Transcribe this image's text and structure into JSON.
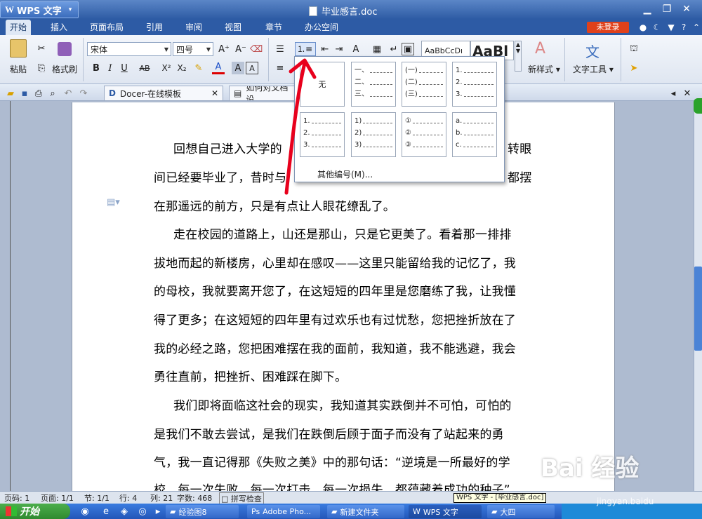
{
  "window": {
    "app_name": "WPS 文字",
    "doc_title": "毕业感言.doc"
  },
  "menu": {
    "tabs": [
      "开始",
      "插入",
      "页面布局",
      "引用",
      "审阅",
      "视图",
      "章节",
      "办公空间"
    ],
    "login": "未登录"
  },
  "ribbon": {
    "paste": "粘贴",
    "format_painter": "格式刷",
    "font_name": "宋体",
    "font_size": "四号",
    "styles_preview_1": "AaBbCcDı",
    "styles_preview_2": "AaBl",
    "new_style": "新样式",
    "text_tools": "文字工具"
  },
  "doc_tabs": [
    {
      "label": "Docer-在线模板"
    },
    {
      "label": "如何对文档设"
    }
  ],
  "numbering_dropdown": {
    "none_label": "无",
    "styles": [
      {
        "items": [
          "一、",
          "二、",
          "三、"
        ]
      },
      {
        "items": [
          "(一)",
          "(二)",
          "(三)"
        ]
      },
      {
        "items": [
          "1.",
          "2.",
          "3."
        ]
      },
      {
        "items": [
          "1.",
          "2.",
          "3."
        ]
      },
      {
        "items": [
          "1)",
          "2)",
          "3)"
        ]
      },
      {
        "items": [
          "①",
          "②",
          "③"
        ]
      },
      {
        "items": [
          "a.",
          "b.",
          "c."
        ]
      }
    ],
    "more": "其他编号(M)..."
  },
  "document": {
    "lines": [
      "回想自己进入大学的",
      "间已经要毕业了，昔时与",
      "在那遥远的前方，只是有点让人眼花缭乱了。",
      "走在校园的道路上，山还是那山，只是它更美了。看着那一排排",
      "拔地而起的新楼房，心里却在感叹——这里只能留给我的记忆了，我",
      "的母校，我就要离开您了，在这短短的四年里是您磨练了我，让我懂",
      "得了更多；在这短短的四年里有过欢乐也有过忧愁，您把挫折放在了",
      "我的必经之路，您把困难摆在我的面前，我知道，我不能逃避，我会",
      "勇往直前，把挫折、困难踩在脚下。",
      "我们即将面临这社会的现实，我知道其实跌倒并不可怕，可怕的",
      "是我们不敢去尝试，是我们在跌倒后顾于面子而没有了站起来的勇",
      "气，我一直记得那《失败之美》中的那句话：“逆境是一所最好的学",
      "校，每一次失败，每一次打击，每一次损失，都蕴藏着成功的种子”"
    ],
    "line1_tail": "转眼",
    "line2_tail": "都摆"
  },
  "status": {
    "page_code": "页码: 1",
    "page": "页面: 1/1",
    "section": "节: 1/1",
    "row": "行: 4",
    "col": "列: 21",
    "chars": "字数: 468",
    "spell": "拼写检查"
  },
  "tooltip": "WPS 文字 - [毕业感言.doc]",
  "taskbar": {
    "start": "开始",
    "tasks": [
      "经验图8",
      "Adobe Pho...",
      "新建文件夹",
      "WPS 文字",
      "大四"
    ]
  },
  "watermark": {
    "main": "Bai 经验",
    "sub": "jingyan.baidu"
  }
}
